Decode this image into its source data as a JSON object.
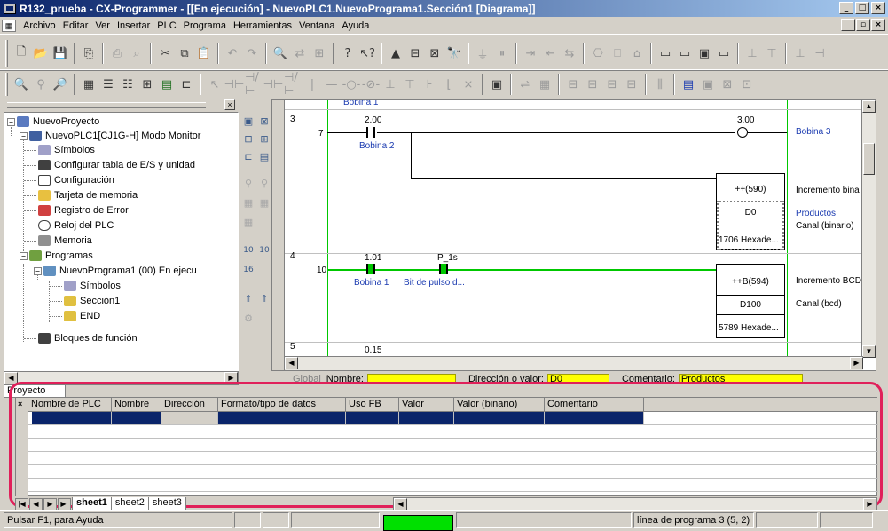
{
  "window": {
    "title": "R132_prueba - CX-Programmer - [[En ejecución] - NuevoPLC1.NuevoPrograma1.Sección1 [Diagrama]]"
  },
  "menu": [
    "Archivo",
    "Editar",
    "Ver",
    "Insertar",
    "PLC",
    "Programa",
    "Herramientas",
    "Ventana",
    "Ayuda"
  ],
  "tree": {
    "nodes": [
      {
        "label": "NuevoProyecto",
        "icon": "project-icon"
      },
      {
        "label": "NuevoPLC1[CJ1G-H] Modo Monitor",
        "icon": "plc-icon"
      },
      {
        "label": "Símbolos",
        "icon": "symbols-icon"
      },
      {
        "label": "Configurar tabla de E/S y unidad",
        "icon": "io-table-icon"
      },
      {
        "label": "Configuración",
        "icon": "settings-icon"
      },
      {
        "label": "Tarjeta de memoria",
        "icon": "memory-card-icon"
      },
      {
        "label": "Registro de Error",
        "icon": "error-log-icon"
      },
      {
        "label": "Reloj del PLC",
        "icon": "clock-icon"
      },
      {
        "label": "Memoria",
        "icon": "memory-icon"
      },
      {
        "label": "Programas",
        "icon": "programs-icon"
      },
      {
        "label": "NuevoPrograma1 (00) En ejecu",
        "icon": "program-icon"
      },
      {
        "label": "Símbolos",
        "icon": "symbols-icon"
      },
      {
        "label": "Sección1",
        "icon": "section-icon"
      },
      {
        "label": "END",
        "icon": "section-icon"
      },
      {
        "label": "Bloques de función",
        "icon": "function-blocks-icon"
      }
    ],
    "tab": "Proyecto"
  },
  "ladder": {
    "top_label": "Bobina 1",
    "rungs": [
      {
        "rung": "3",
        "step": "7",
        "contact_addr": "2.00",
        "contact_name": "Bobina 2",
        "coil_addr": "3.00",
        "coil_name": "Bobina 3",
        "fb_instr": "++(590)",
        "fb_instr_desc": "Incremento bina",
        "fb_operand": "D0",
        "fb_operand_name": "Productos",
        "fb_operand_desc": "Canal (binario)",
        "fb_value": "1706 Hexade..."
      },
      {
        "rung": "4",
        "step": "10",
        "contact1_addr": "1.01",
        "contact1_name": "Bobina 1",
        "contact2_addr": "P_1s",
        "contact2_name": "Bit de pulso d...",
        "fb_instr": "++B(594)",
        "fb_instr_desc": "Incremento BCD",
        "fb_operand": "D100",
        "fb_operand_desc": "Canal (bcd)",
        "fb_value": "5789 Hexade..."
      },
      {
        "rung": "5",
        "contact_addr": "0.15"
      }
    ]
  },
  "infobar": {
    "global_label": "Global",
    "name_label": "Nombre:",
    "name_value": "",
    "addr_label": "Dirección o valor:",
    "addr_value": "D0",
    "comment_label": "Comentario:",
    "comment_value": "Productos"
  },
  "watch": {
    "columns": [
      "Nombre de PLC",
      "Nombre",
      "Dirección",
      "Formato/tipo de datos",
      "Uso FB",
      "Valor",
      "Valor (binario)",
      "Comentario"
    ],
    "sheets": [
      "sheet1",
      "sheet2",
      "sheet3"
    ]
  },
  "status": {
    "help": "Pulsar F1, para Ayuda",
    "line": "línea de programa 3 (5, 2)"
  },
  "colors": {
    "active_title": "#0a246a",
    "rung_green": "#00c800",
    "highlight_frame": "#e0205a",
    "info_yellow": "#ffff00"
  }
}
